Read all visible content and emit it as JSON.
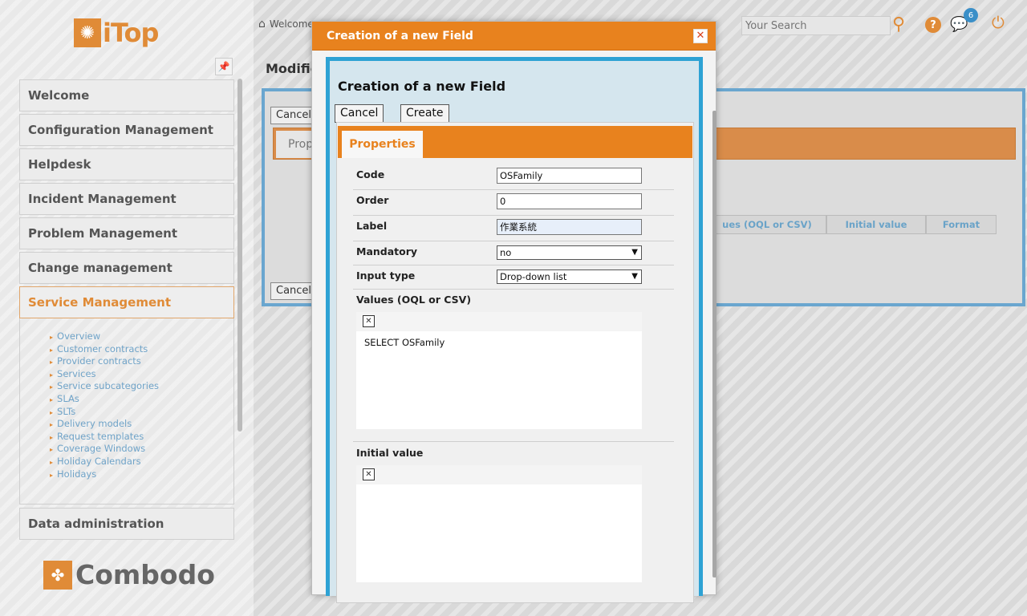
{
  "app": {
    "logo_text": "iTop",
    "footer_logo_text": "Combodo"
  },
  "sidebar": {
    "menus": [
      {
        "label": "Welcome"
      },
      {
        "label": "Configuration Management"
      },
      {
        "label": "Helpdesk"
      },
      {
        "label": "Incident Management"
      },
      {
        "label": "Problem Management"
      },
      {
        "label": "Change management"
      },
      {
        "label": "Service Management"
      },
      {
        "label": "Data administration"
      }
    ],
    "submenu": [
      "Overview",
      "Customer contracts",
      "Provider contracts",
      "Services",
      "Service subcategories",
      "SLAs",
      "SLTs",
      "Delivery models",
      "Request templates",
      "Coverage Windows",
      "Holiday Calendars",
      "Holidays"
    ]
  },
  "topbar": {
    "breadcrumb": "Welcome",
    "search_placeholder": "Your Search",
    "notification_count": "6"
  },
  "background_page": {
    "title": "Modific",
    "cancel_label": "Cancel",
    "properties_tab": "Prop",
    "columns": [
      "ues (OQL or CSV)",
      "Initial value",
      "Format"
    ]
  },
  "modal": {
    "title": "Creation of a new Field",
    "heading": "Creation of a new Field",
    "cancel_label": "Cancel",
    "create_label": "Create",
    "tab_label": "Properties",
    "fields": {
      "code": {
        "label": "Code",
        "value": "OSFamily"
      },
      "order": {
        "label": "Order",
        "value": "0"
      },
      "label": {
        "label": "Label",
        "value": "作業系統"
      },
      "mandatory": {
        "label": "Mandatory",
        "value": "no"
      },
      "input_type": {
        "label": "Input type",
        "value": "Drop-down list"
      },
      "values": {
        "label": "Values (OQL or CSV)",
        "value": "SELECT OSFamily"
      },
      "initial_value": {
        "label": "Initial value",
        "value": ""
      }
    }
  }
}
